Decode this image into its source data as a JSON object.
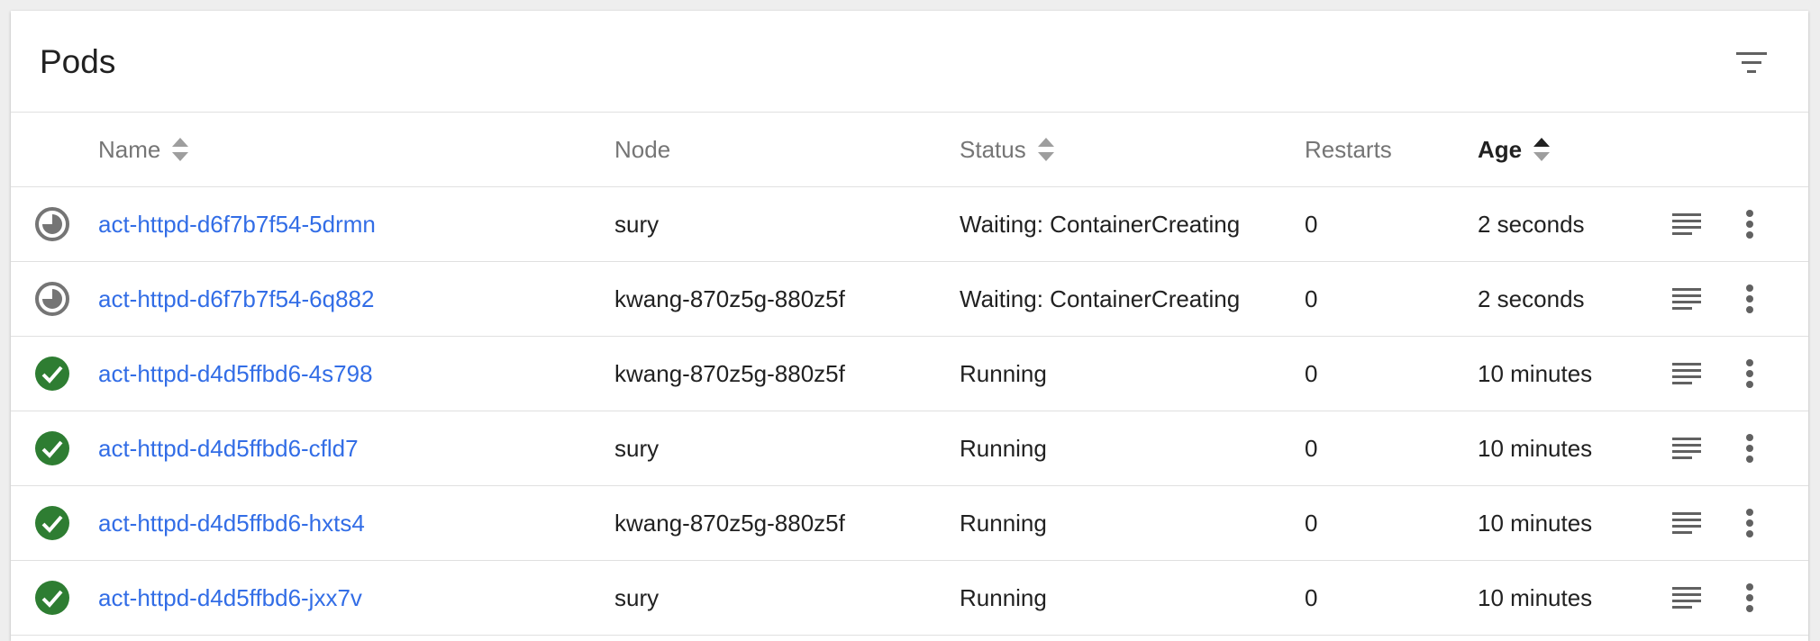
{
  "card": {
    "title": "Pods"
  },
  "columns": {
    "name": "Name",
    "node": "Node",
    "status": "Status",
    "restarts": "Restarts",
    "age": "Age"
  },
  "rows": [
    {
      "status_icon": "pending-clock-icon",
      "name": "act-httpd-d6f7b7f54-5drmn",
      "node": "sury",
      "status": "Waiting: ContainerCreating",
      "restarts": "0",
      "age": "2 seconds"
    },
    {
      "status_icon": "pending-clock-icon",
      "name": "act-httpd-d6f7b7f54-6q882",
      "node": "kwang-870z5g-880z5f",
      "status": "Waiting: ContainerCreating",
      "restarts": "0",
      "age": "2 seconds"
    },
    {
      "status_icon": "check-circle-icon",
      "name": "act-httpd-d4d5ffbd6-4s798",
      "node": "kwang-870z5g-880z5f",
      "status": "Running",
      "restarts": "0",
      "age": "10 minutes"
    },
    {
      "status_icon": "check-circle-icon",
      "name": "act-httpd-d4d5ffbd6-cfld7",
      "node": "sury",
      "status": "Running",
      "restarts": "0",
      "age": "10 minutes"
    },
    {
      "status_icon": "check-circle-icon",
      "name": "act-httpd-d4d5ffbd6-hxts4",
      "node": "kwang-870z5g-880z5f",
      "status": "Running",
      "restarts": "0",
      "age": "10 minutes"
    },
    {
      "status_icon": "check-circle-icon",
      "name": "act-httpd-d4d5ffbd6-jxx7v",
      "node": "sury",
      "status": "Running",
      "restarts": "0",
      "age": "10 minutes"
    }
  ],
  "colors": {
    "link": "#326de6",
    "success": "#2e7d32",
    "pending": "#757575",
    "text": "#212121",
    "muted": "#757575"
  }
}
